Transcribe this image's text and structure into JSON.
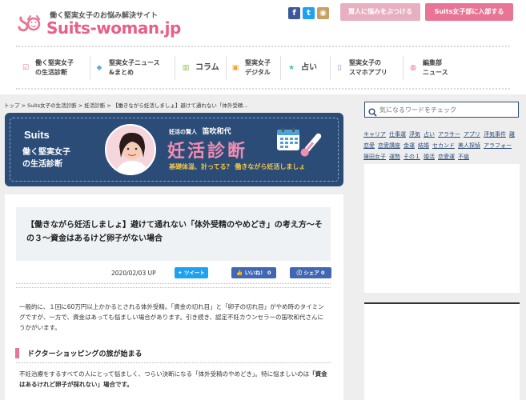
{
  "header": {
    "tagline": "働く堅実女子のお悩み解決サイト",
    "logo_text": "Suits-woman.jp",
    "sns": [
      {
        "name": "facebook",
        "glyph": "f",
        "color": "#3b5998"
      },
      {
        "name": "twitter",
        "glyph": "t",
        "color": "#1da1f2"
      },
      {
        "name": "feedly",
        "glyph": "◉",
        "color": "#c9a063"
      }
    ],
    "consult_button": "賢人に悩みをぶつける",
    "join_button": "Suits女子部に入部する"
  },
  "nav": [
    {
      "line1": "働く堅実女子",
      "line2": "の生活診断",
      "icon": "checklist-icon",
      "glyph": "☑",
      "color": "#e97596"
    },
    {
      "line1": "堅実女子ニュース",
      "line2": "&まとめ",
      "icon": "tag-icon",
      "glyph": "◆",
      "color": "#6aa9d8"
    },
    {
      "line1": "コラム",
      "line2": "",
      "icon": "book-icon",
      "glyph": "▥",
      "color": "#8bc34a"
    },
    {
      "line1": "堅実女子",
      "line2": "デジタル",
      "icon": "lock-icon",
      "glyph": "▣",
      "color": "#f0a030"
    },
    {
      "line1": "占い",
      "line2": "",
      "icon": "star-icon",
      "glyph": "★",
      "color": "#4cc3b0"
    },
    {
      "line1": "堅実女子の",
      "line2": "スマホアプリ",
      "icon": "smartphone-icon",
      "glyph": "▯",
      "color": "#9b7fd1"
    },
    {
      "line1": "編集部",
      "line2": "ニュース",
      "icon": "speech-bubble-icon",
      "glyph": "◍",
      "color": "#e97596"
    }
  ],
  "breadcrumb": [
    "トップ",
    "Suits女子の生活診断",
    "妊活診断",
    "【働きながら妊活しましょ】避けて通れない「体外受精..."
  ],
  "breadcrumb_sep": ">",
  "banner": {
    "logo": "Suits",
    "subtitle_line1": "働く堅実女子",
    "subtitle_line2": "の生活診断",
    "author_label": "妊活の賢人",
    "author_name": "笛吹和代",
    "title": "妊活診断",
    "tagline": "基礎体温、計ってる？ 働きながら妊活しましょ"
  },
  "article": {
    "title": "【働きながら妊活しましょ】避けて通れない「体外受精のやめどき」の考え方〜その３〜資金はあるけど卵子がない場合",
    "date": "2020/02/03 UP",
    "share": [
      {
        "label": "ツイート",
        "color": "#1da1f2"
      },
      {
        "label": "いいね！ 0",
        "color": "#4267b2"
      },
      {
        "label": "シェア 0",
        "color": "#4267b2"
      }
    ],
    "intro": "一般的に、１回に60万円以上かかるとされる体外受精。「資金の切れ目」と「卵子の切れ目」がやめ時のタイミングですが、一方で、資金はあっても悩ましい場合があります。引き続き、認定不妊カウンセラーの笛吹和代さんにうかがいます。",
    "heading": "ドクターショッピングの旅が始まる",
    "body_part1": "不妊治療をするすべての人にとって悩ましく、つらい決断になる「体外受精のやめどき」。特に悩ましいのは",
    "body_bold": "「資金はあるけれど卵子が採れない」場合です。"
  },
  "sidebar": {
    "search_placeholder": "気になるワードをチェック",
    "tags": [
      "キャリア",
      "仕事運",
      "浮気",
      "占い",
      "アラサー",
      "アプリ",
      "浮気事件",
      "離",
      "恋愛",
      "恋愛講座",
      "金運",
      "結婚",
      "セカンド",
      "美人探偵",
      "アラフォー",
      "篠田女子",
      "運勢",
      "その１",
      "婚活",
      "恋愛運",
      "不倫"
    ]
  }
}
